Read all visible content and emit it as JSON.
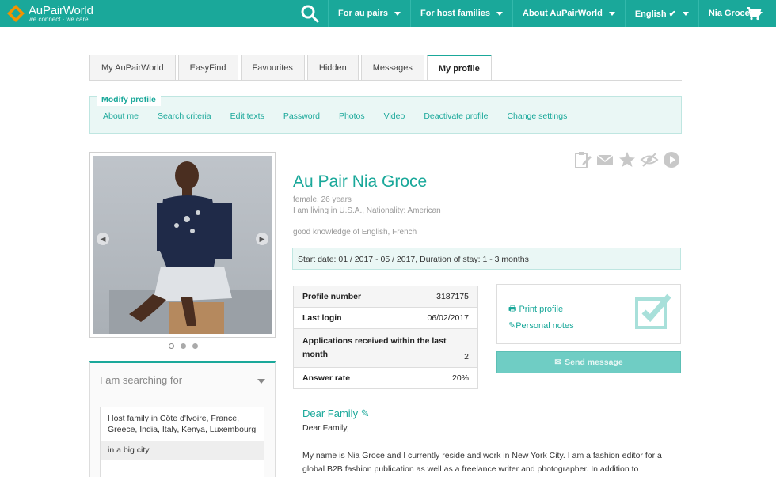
{
  "header": {
    "logo_name": "AuPairWorld",
    "logo_tagline": "we connect · we care",
    "nav": [
      {
        "label": "For au pairs"
      },
      {
        "label": "For host families"
      },
      {
        "label": "About AuPairWorld"
      },
      {
        "label": "English ✔"
      },
      {
        "label": "Nia Groce"
      }
    ],
    "icons": [
      "search-icon",
      "cart-icon"
    ]
  },
  "tabs": [
    {
      "label": "My AuPairWorld"
    },
    {
      "label": "EasyFind"
    },
    {
      "label": "Favourites"
    },
    {
      "label": "Hidden"
    },
    {
      "label": "Messages"
    },
    {
      "label": "My profile",
      "active": true
    }
  ],
  "subnav": {
    "heading": "Modify profile",
    "links": [
      "About me",
      "Search criteria",
      "Edit texts",
      "Password",
      "Photos",
      "Video",
      "Deactivate profile",
      "Change settings"
    ]
  },
  "profile": {
    "name": "Au Pair Nia Groce",
    "meta1": "female, 26 years",
    "meta2": "I am living in U.S.A., Nationality: American",
    "meta3": "good knowledge of English, French",
    "start": "Start date: 01 / 2017 - 05 / 2017, Duration of stay: 1 - 3 months"
  },
  "stats": [
    {
      "label": "Profile number",
      "value": "3187175"
    },
    {
      "label": "Last login",
      "value": "06/02/2017"
    },
    {
      "label": "Applications received within the last month",
      "value": "2"
    },
    {
      "label": "Answer rate",
      "value": "20%"
    }
  ],
  "actions_box": {
    "print": "Print profile",
    "notes": "Personal notes",
    "send": "Send message"
  },
  "searching": {
    "title": "I am searching for",
    "item1": "Host family in Côte d'Ivoire, France, Greece, India, Italy, Kenya, Luxembourg",
    "item2": "in a big city"
  },
  "letter": {
    "title": "Dear Family",
    "salutation": "Dear Family,",
    "body": "My name is Nia Groce and I currently reside and work in New York City. I am a fashion editor for a global B2B fashion publication as well as a freelance writer and photographer. In addition to"
  },
  "colors": {
    "brand": "#1aa89a",
    "brand_light": "#eaf7f5",
    "button_disabled": "#6fcdc4"
  },
  "photo_carousel": {
    "total": 3,
    "current": 1
  }
}
